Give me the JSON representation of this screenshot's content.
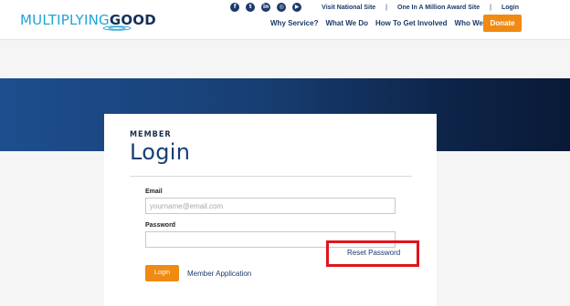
{
  "header": {
    "logo": {
      "part1": "MULTIPLYING",
      "part2": "GOOD"
    },
    "social_icons": [
      "facebook-icon",
      "twitter-icon",
      "linkedin-icon",
      "instagram-icon",
      "youtube-icon"
    ],
    "toplinks": [
      "Visit National Site",
      "One In A Million Award Site",
      "Login"
    ],
    "separator": "|",
    "nav": [
      "Why Service?",
      "What We Do",
      "How To Get Involved",
      "Who We Are"
    ],
    "donate_label": "Donate"
  },
  "login_card": {
    "kicker": "MEMBER",
    "title": "Login",
    "email_label": "Email",
    "email_placeholder": "yourname@email.com",
    "email_value": "",
    "password_label": "Password",
    "password_value": "",
    "reset_label": "Reset Password",
    "login_button": "Login",
    "member_application": "Member Application"
  },
  "colors": {
    "brand_navy": "#173f74",
    "accent_orange": "#f08a12",
    "logo_light_blue": "#1fa3d6",
    "highlight_red": "#e1141c"
  }
}
